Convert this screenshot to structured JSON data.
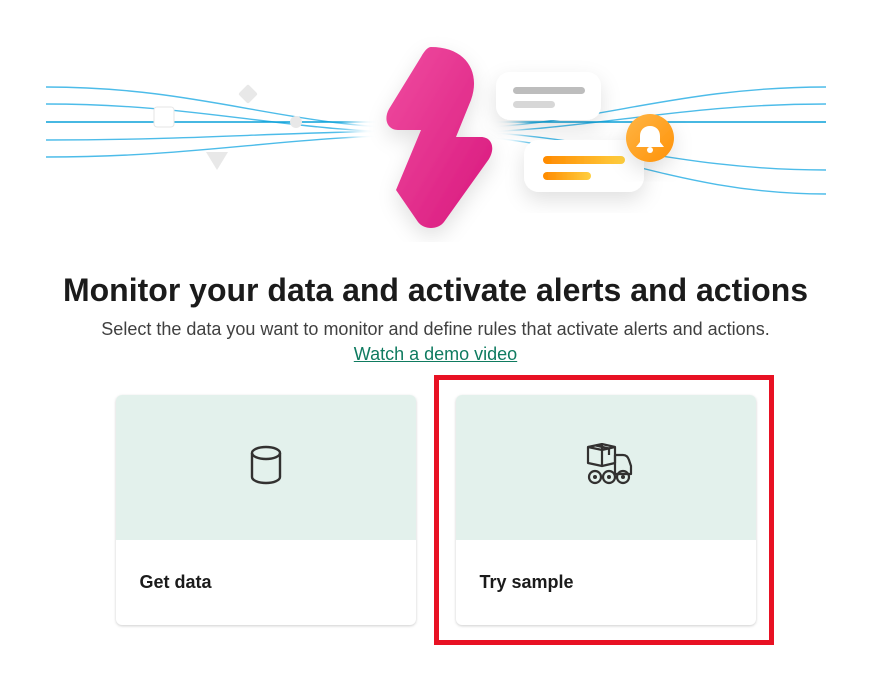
{
  "heading": "Monitor your data and activate alerts and actions",
  "subheading": "Select the data you want to monitor and define rules that activate alerts and actions.",
  "demo_link": "Watch a demo video",
  "cards": {
    "get_data": {
      "label": "Get data"
    },
    "try_sample": {
      "label": "Try sample"
    }
  }
}
